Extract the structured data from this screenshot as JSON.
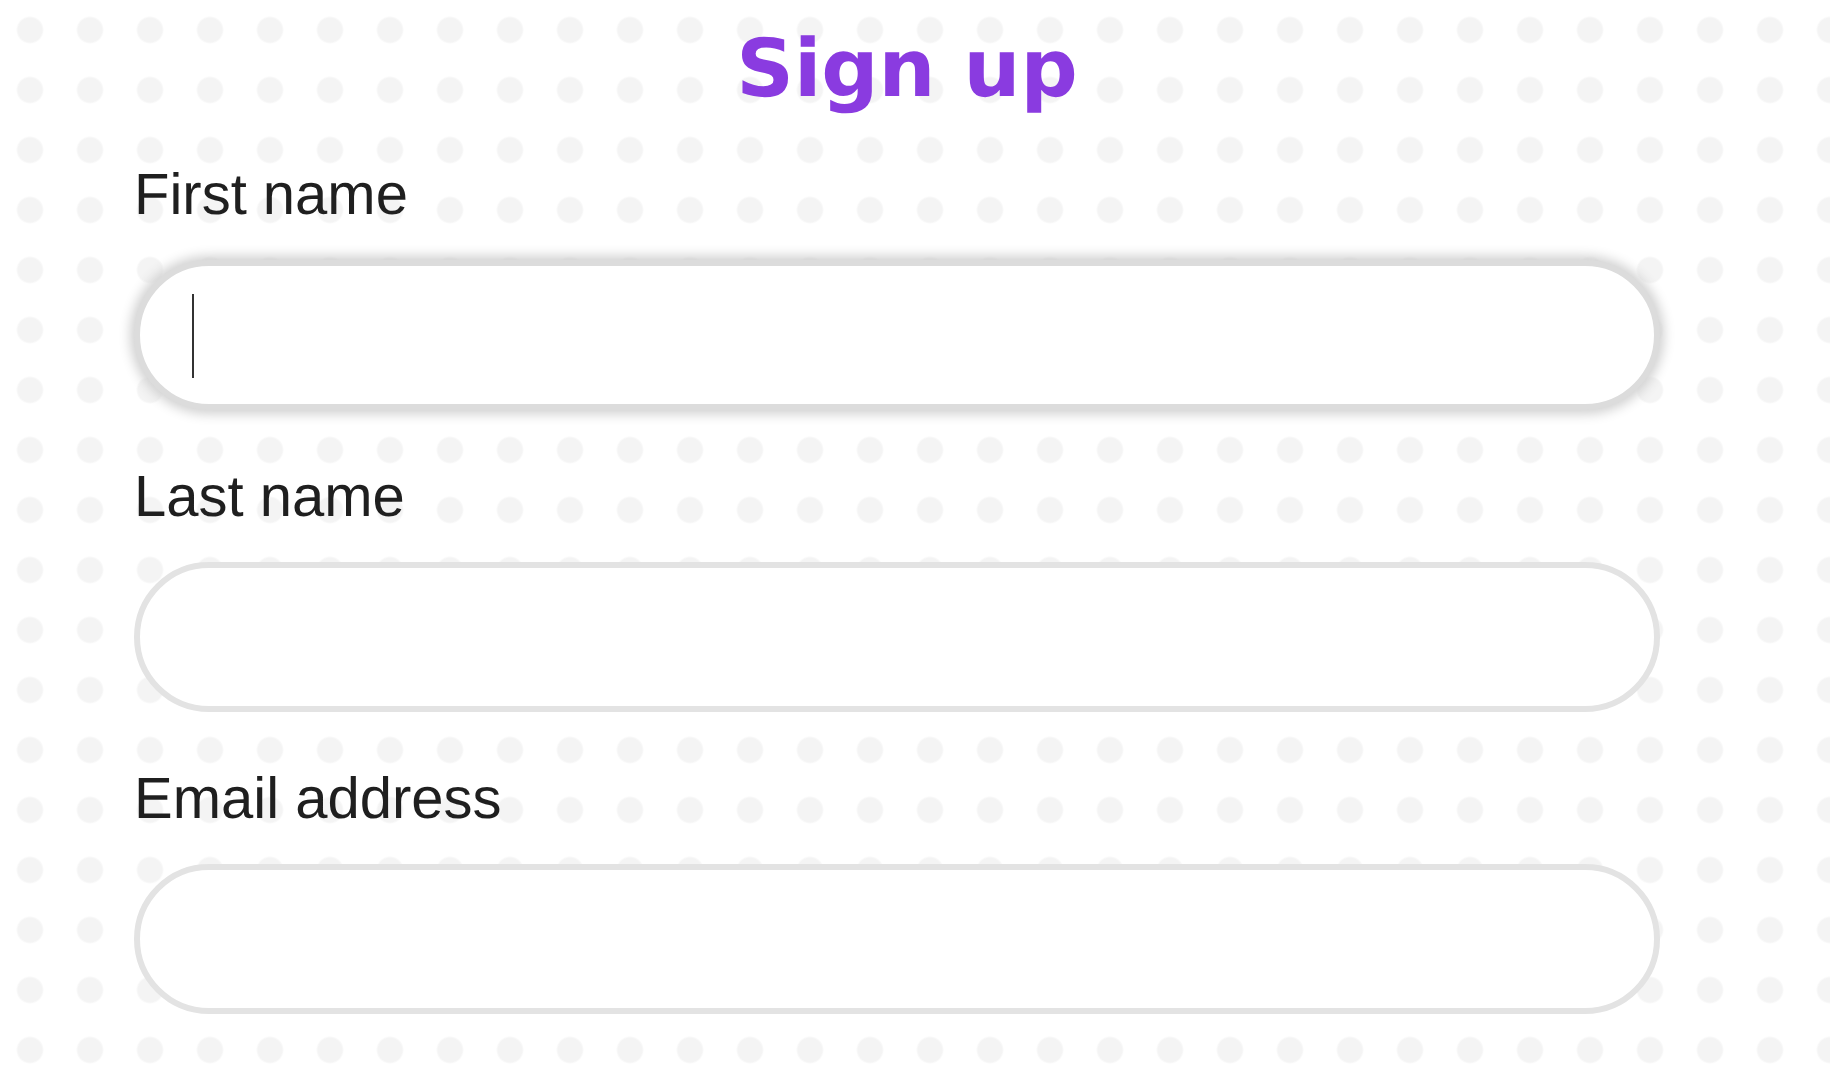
{
  "title": "Sign up",
  "fields": [
    {
      "label": "First name",
      "focused": true
    },
    {
      "label": "Last name",
      "focused": false
    },
    {
      "label": "Email address",
      "focused": false
    }
  ]
}
